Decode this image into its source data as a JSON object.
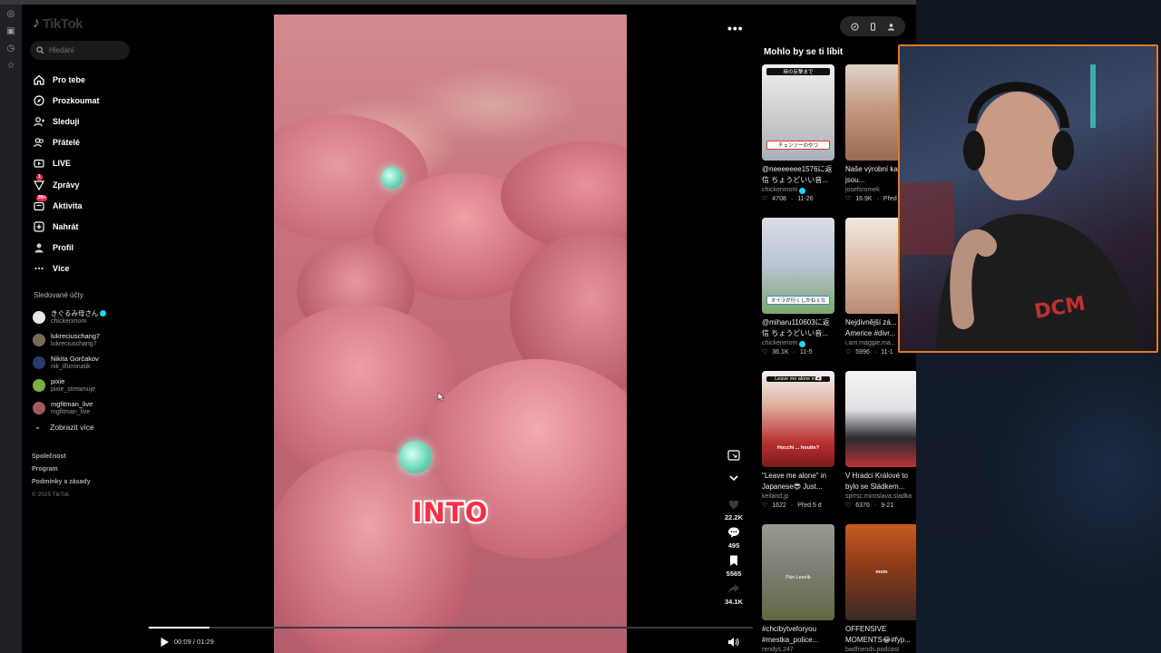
{
  "app": {
    "logo_text": "TikTok"
  },
  "search": {
    "placeholder": "Hledání"
  },
  "nav": [
    {
      "label": "Pro tebe",
      "icon": "home-icon"
    },
    {
      "label": "Prozkoumat",
      "icon": "compass-icon"
    },
    {
      "label": "Sleduji",
      "icon": "user-follow-icon"
    },
    {
      "label": "Přátelé",
      "icon": "friends-icon"
    },
    {
      "label": "LIVE",
      "icon": "live-icon"
    },
    {
      "label": "Zprávy",
      "icon": "messages-icon",
      "badge": "1"
    },
    {
      "label": "Aktivita",
      "icon": "activity-icon",
      "badge": "99+"
    },
    {
      "label": "Nahrát",
      "icon": "upload-icon"
    },
    {
      "label": "Profil",
      "icon": "profile-icon"
    },
    {
      "label": "Více",
      "icon": "more-icon"
    }
  ],
  "following": {
    "title": "Sledované účty",
    "accounts": [
      {
        "name": "きぐるみ母さん",
        "handle": "chickenmom",
        "verified": true,
        "color": "#e8e8e8"
      },
      {
        "name": "lukreciuschang7",
        "handle": "lukreciuschang7",
        "verified": false,
        "color": "#7a6a5a"
      },
      {
        "name": "Nikita Gorčakov",
        "handle": "nik_illuminatik",
        "verified": false,
        "color": "#2a3a6a"
      },
      {
        "name": "pixie",
        "handle": "pixie_streamuje",
        "verified": false,
        "color": "#7bb040"
      },
      {
        "name": "mgfitman_live",
        "handle": "mgfitman_live",
        "verified": false,
        "color": "#a05a60"
      }
    ],
    "show_more": "Zobrazit více"
  },
  "footer": {
    "links": [
      "Společnost",
      "Program",
      "Podmínky a zásady"
    ],
    "copyright": "© 2025 TikTok"
  },
  "video": {
    "caption": "INTO",
    "time": "00:09 / 01:29",
    "progress": 0.1,
    "likes": "22.2K",
    "comments": "495",
    "saves": "5565",
    "shares": "34.1K"
  },
  "recommended": {
    "title": "Mohlo by se ti líbit",
    "items": [
      {
        "title": "@neeeeeee1576に返信 ちょうどいい音...",
        "author": "chickenmom",
        "verified": true,
        "likes": "4708",
        "date": "11-26",
        "thumb": "#d8d8d8",
        "label": "チェンソーのやつ",
        "label_top": "時の反撃まで"
      },
      {
        "title": "Naše výrobní kapacity jsou...",
        "author": "josefsromek",
        "verified": false,
        "likes": "16.9K",
        "date": "Před",
        "thumb": "#b78a72"
      },
      {
        "title": "@miharu110603に返信 ちょうどいい音...",
        "author": "chickenmom",
        "verified": true,
        "likes": "36.1K",
        "date": "11-5",
        "thumb": "#cfd6e0",
        "label": "オイラが行くしかねぇな"
      },
      {
        "title": "Nejdivnější zá... Americe #divr...",
        "author": "i.am.maggie.ma...",
        "verified": false,
        "likes": "5996",
        "date": "11-1",
        "thumb": "#d9b8a8"
      },
      {
        "title": "\"Leave me alone\" in Japanese😎 Just...",
        "author": "keiland.jp",
        "verified": false,
        "likes": "1622",
        "date": "Před 5 d",
        "thumb": "#c93a3a",
        "label": "Leave me alone in🇯🇵",
        "overlay": "Hocchi ... houtte?"
      },
      {
        "title": "V Hradci Králové to bylo se Sládkem...",
        "author": "sprrsc.miroslava.sladka",
        "verified": false,
        "likes": "6376",
        "date": "9-21",
        "thumb": "#e6e6ea"
      },
      {
        "title": "#chcibytveforyou #mestka_police...",
        "author": "rendys.247",
        "verified": false,
        "likes": "",
        "date": "",
        "thumb": "#8a8a82",
        "overlay": "Pán Lesník"
      },
      {
        "title": "OFFENSIVE MOMENTS😂#fyp...",
        "author": "badfriends.podcast",
        "verified": false,
        "likes": "",
        "date": "",
        "thumb": "#b4501e",
        "overlay": "mom"
      }
    ]
  },
  "colors": {
    "accent": "#fe2c55",
    "verified": "#20d5ec",
    "webcam_border": "#e07a2e"
  }
}
